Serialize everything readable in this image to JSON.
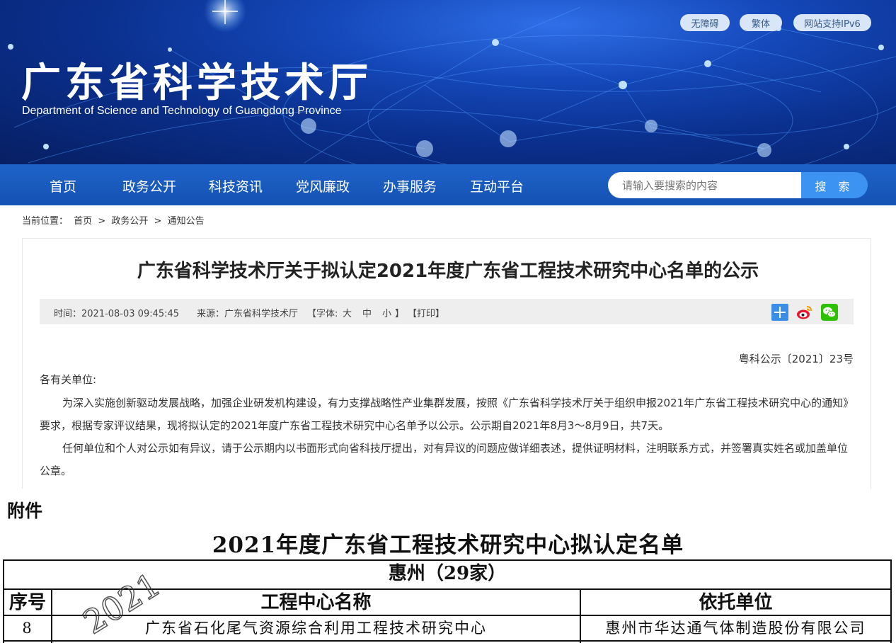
{
  "header": {
    "site_title": "广东省科学技术厅",
    "site_subtitle": "Department of Science and Technology of Guangdong Province",
    "top_links": [
      "无障碍",
      "繁体",
      "网站支持IPv6"
    ]
  },
  "nav": {
    "items": [
      "首页",
      "政务公开",
      "科技资讯",
      "党风廉政",
      "办事服务",
      "互动平台"
    ],
    "search_placeholder": "请输入要搜索的内容",
    "search_button": "搜 索"
  },
  "breadcrumb": {
    "prefix": "当前位置：",
    "items": [
      "首页",
      "政务公开",
      "通知公告"
    ],
    "separator": ">"
  },
  "article": {
    "title": "广东省科学技术厅关于拟认定2021年度广东省工程技术研究中心名单的公示",
    "time": "时间：2021-08-03 09:45:45",
    "source": "来源：广东省科学技术厅",
    "font_label": "【字体:",
    "font_large": "大",
    "font_medium": "中",
    "font_small": "小",
    "font_close": "】",
    "print": "【打印】",
    "doc_number": "粤科公示〔2021〕23号",
    "salutation": "各有关单位:",
    "paragraph1": "为深入实施创新驱动发展战略，加强企业研发机构建设，有力支撑战略性产业集群发展，按照《广东省科学技术厅关于组织申报2021年广东省工程技术研究中心的通知》要求，根据专家评议结果，现将拟认定的2021年度广东省工程技术研究中心名单予以公示。公示期自2021年8月3～8月9日，共7天。",
    "paragraph2": "任何单位和个人对公示如有异议，请于公示期内以书面形式向省科技厅提出，对有异议的问题应做详细表述，提供证明材料，注明联系方式，并签署真实姓名或加盖单位公章。"
  },
  "attachment": {
    "label": "附件",
    "list_title": "2021年度广东省工程技术研究中心拟认定名单",
    "watermark": "2021",
    "region": "惠州（29家）",
    "headers": [
      "序号",
      "工程中心名称",
      "依托单位"
    ],
    "rows": [
      [
        "8",
        "广东省石化尾气资源综合利用工程技术研究中心",
        "惠州市华达通气体制造股份有限公司"
      ]
    ]
  },
  "colors": {
    "nav_bg": "#1a5bbf",
    "search_button": "#3c93f2",
    "banner_dark": "#0a2f8c"
  }
}
